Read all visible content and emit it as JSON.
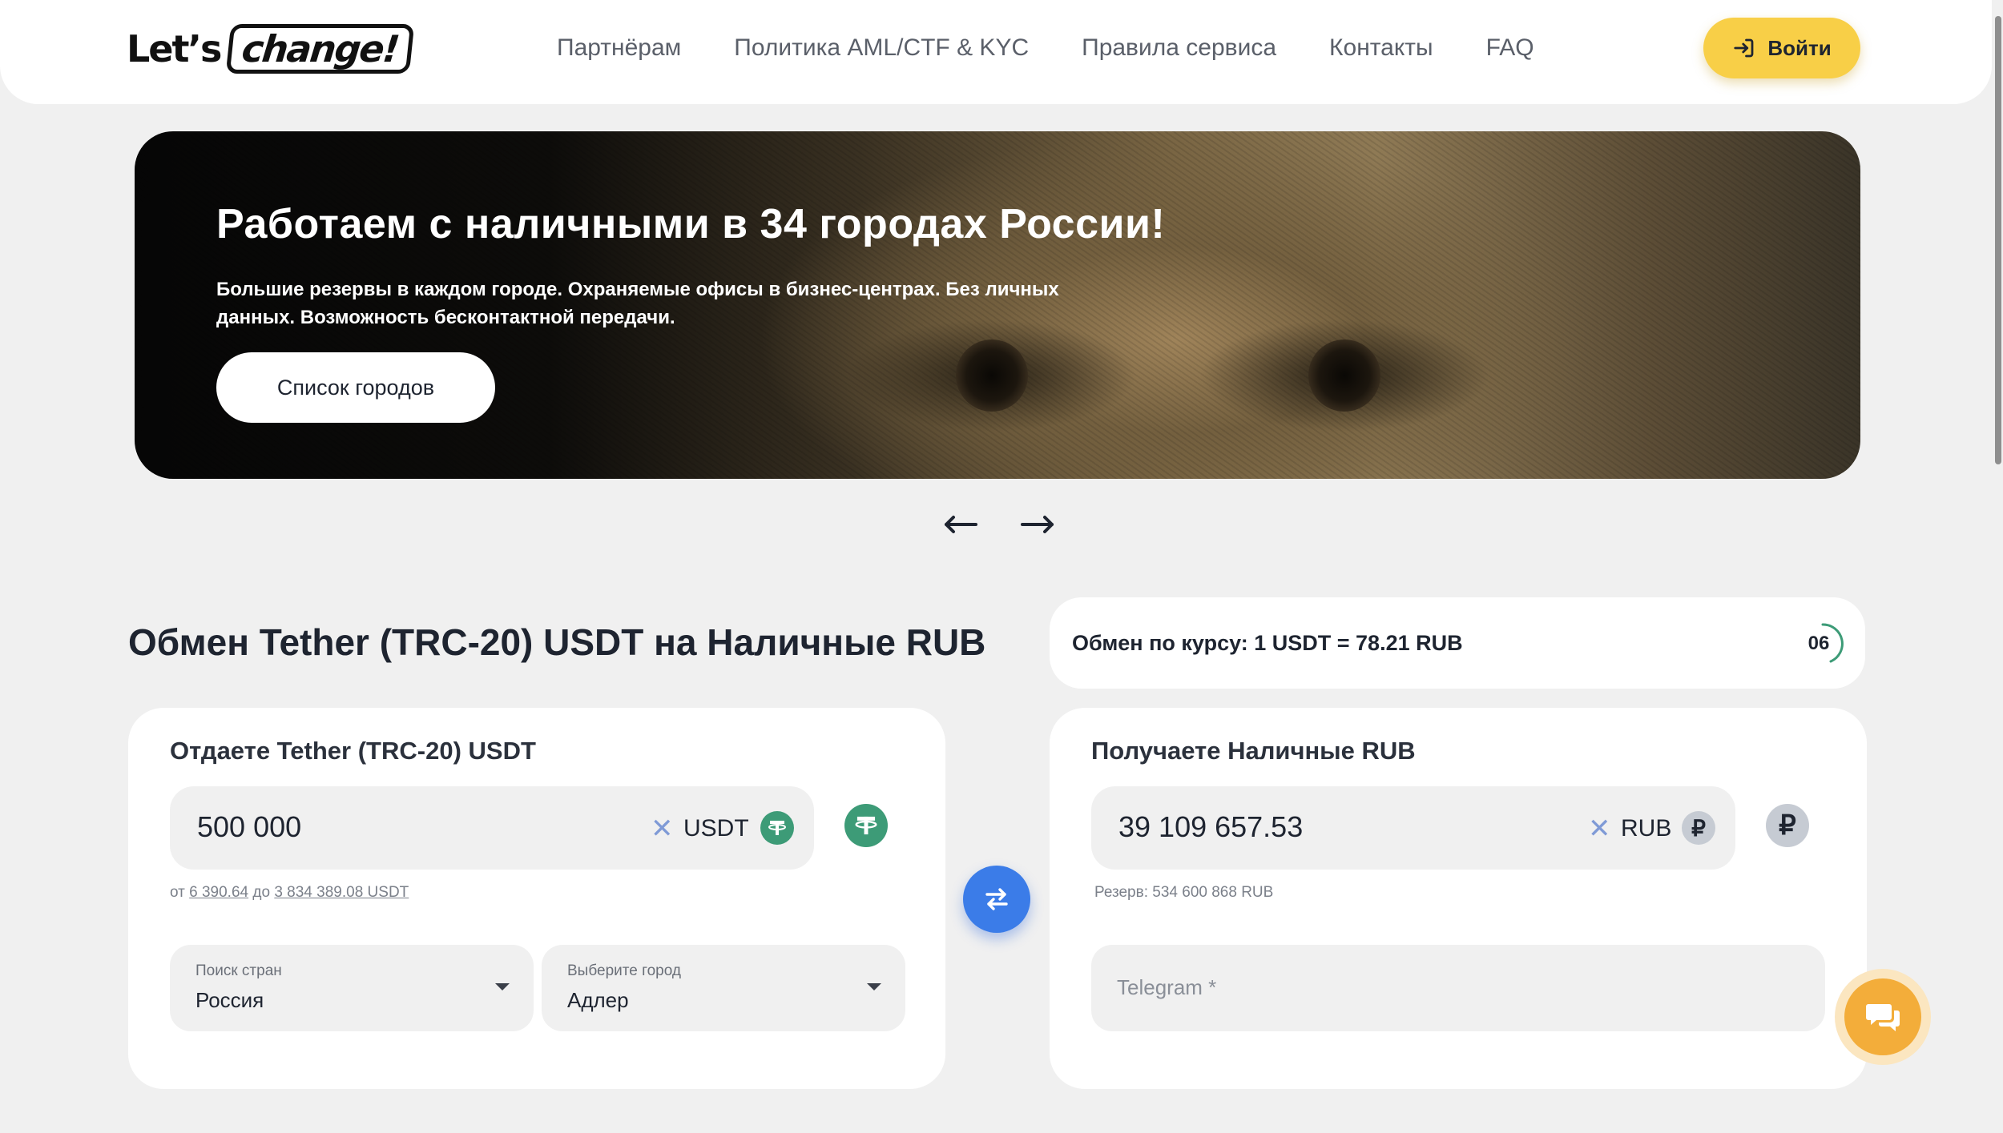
{
  "header": {
    "logo_lets": "Let’s",
    "logo_change": "change!",
    "nav": [
      {
        "label": "Партнёрам"
      },
      {
        "label": "Политика AML/CTF & KYC"
      },
      {
        "label": "Правила сервиса"
      },
      {
        "label": "Контакты"
      },
      {
        "label": "FAQ"
      }
    ],
    "login_label": "Войти",
    "login_icon": "login-arrow-icon"
  },
  "banner": {
    "title": "Работаем с наличными в 34 городах России!",
    "subtitle": "Большие резервы в каждом городе. Охраняемые офисы в бизнес-центрах. Без личных данных. Возможность бесконтактной передачи.",
    "button_label": "Список городов"
  },
  "carousel": {
    "prev_icon": "arrow-left-icon",
    "next_icon": "arrow-right-icon"
  },
  "exchange": {
    "title": "Обмен Tether (TRC-20) USDT на Наличные RUB",
    "rate_text": "Обмен по курсу: 1 USDT = 78.21 RUB",
    "timer": "06",
    "give": {
      "label": "Отдаете Tether (TRC-20) USDT",
      "amount": "500 000",
      "currency": "USDT",
      "limits_from_label": "от",
      "limits_from": "6 390.64",
      "limits_to_label": "до",
      "limits_to": "3 834 389.08 USDT",
      "country_caption": "Поиск стран",
      "country_value": "Россия",
      "city_caption": "Выберите город",
      "city_value": "Адлер"
    },
    "receive": {
      "label": "Получаете Наличные RUB",
      "amount": "39 109 657.53",
      "currency": "RUB",
      "reserve": "Резерв: 534 600 868 RUB",
      "telegram_placeholder": "Telegram *"
    }
  },
  "colors": {
    "accent_yellow": "#f8cf47",
    "swap_blue": "#3b7ce8",
    "usdt_green": "#3d9b77",
    "chat_orange": "#f3ad3a"
  }
}
